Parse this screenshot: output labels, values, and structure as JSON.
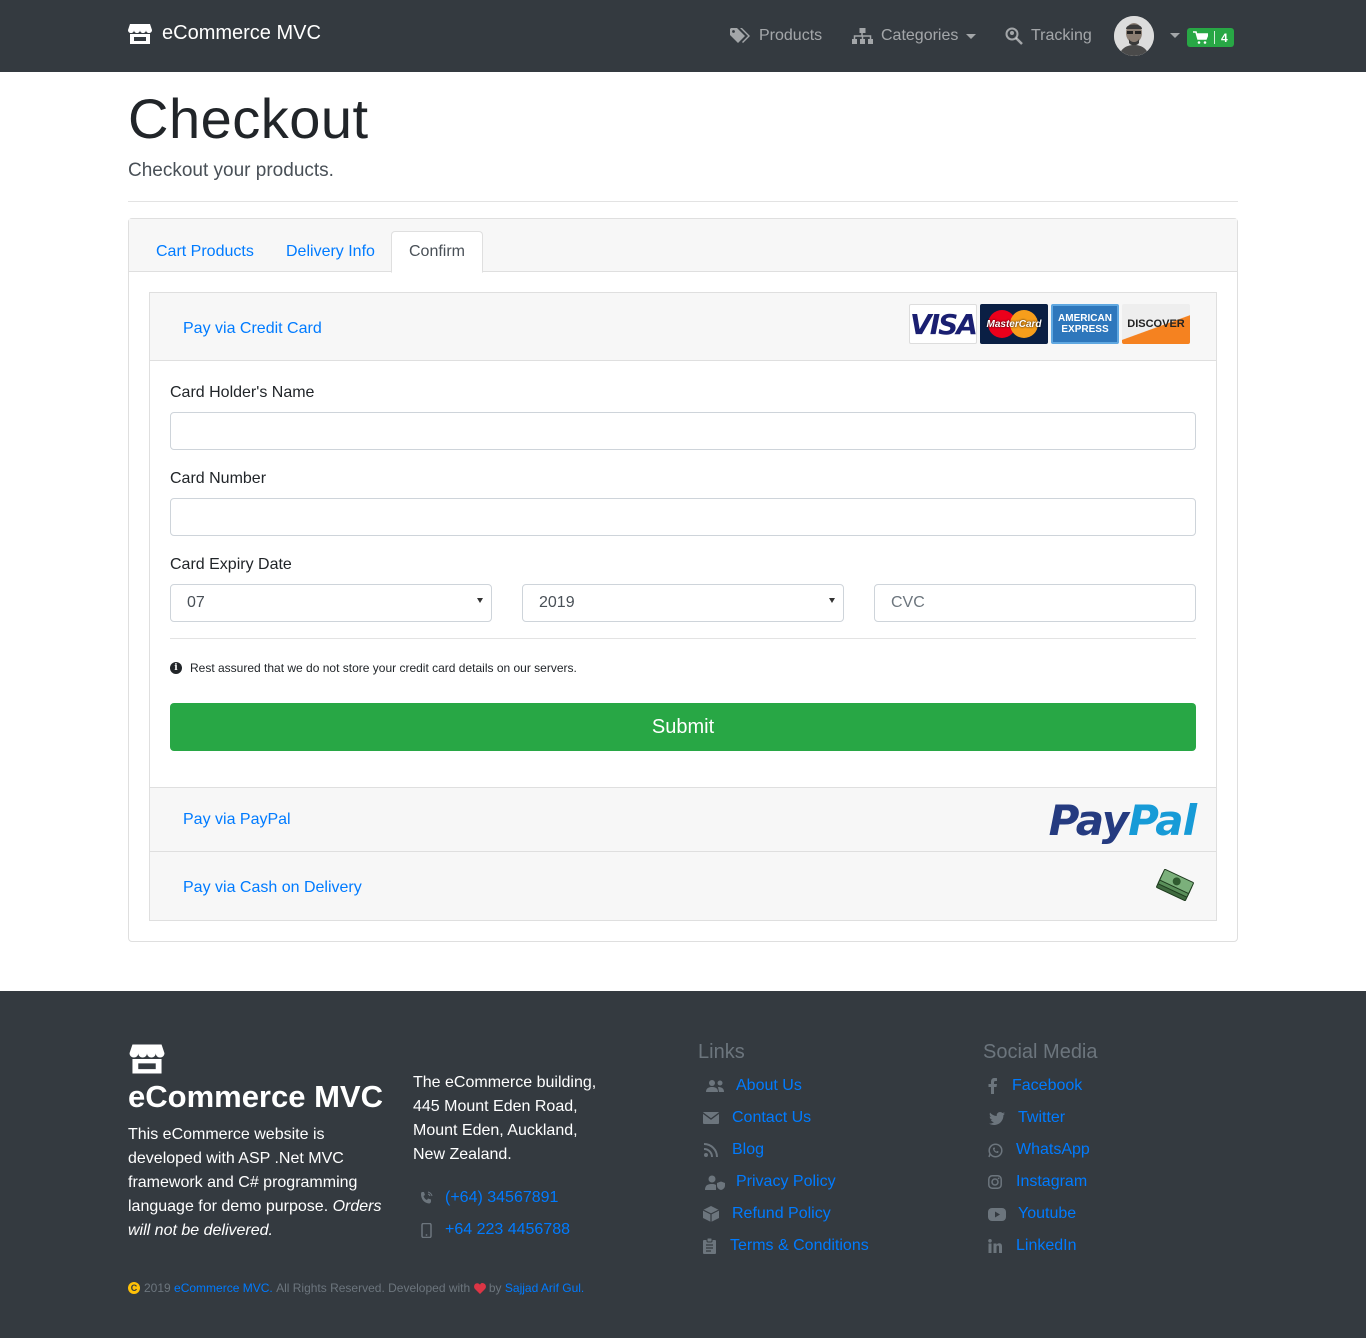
{
  "navbar": {
    "brand": "eCommerce MVC",
    "products": "Products",
    "categories": "Categories",
    "tracking": "Tracking",
    "cart_count": "4"
  },
  "header": {
    "title": "Checkout",
    "subtitle": "Checkout your products."
  },
  "tabs": [
    "Cart Products",
    "Delivery Info",
    "Confirm"
  ],
  "payment": {
    "credit_card_link": "Pay via Credit Card",
    "card_logos": [
      "VISA",
      "MasterCard",
      "AMERICAN EXPRESS",
      "DISCOVER"
    ],
    "holder_label": "Card Holder's Name",
    "number_label": "Card Number",
    "expiry_label": "Card Expiry Date",
    "month_value": "07",
    "year_value": "2019",
    "cvc_placeholder": "CVC",
    "note": "Rest assured that we do not store your credit card details on our servers.",
    "submit": "Submit",
    "paypal_link": "Pay via PayPal",
    "paypal_logo_a": "Pay",
    "paypal_logo_b": "Pal",
    "cod_link": "Pay via Cash on Delivery"
  },
  "footer": {
    "brand": "eCommerce MVC",
    "desc_plain": "This eCommerce website is developed with ASP .Net MVC framework and C# programming language for demo purpose. ",
    "desc_italic": "Orders will not be delivered.",
    "address_lines": [
      "The eCommerce building,",
      "445 Mount Eden Road,",
      "Mount Eden, Auckland,",
      "New Zealand."
    ],
    "phone": "(+64) 34567891",
    "mobile": "+64 223 4456788",
    "links_heading": "Links",
    "links": [
      "About Us",
      "Contact Us",
      "Blog",
      "Privacy Policy",
      "Refund Policy",
      "Terms & Conditions"
    ],
    "social_heading": "Social Media",
    "social": [
      "Facebook",
      "Twitter",
      "WhatsApp",
      "Instagram",
      "Youtube",
      "LinkedIn"
    ],
    "copy_year": "2019",
    "copy_brand": "eCommerce MVC.",
    "copy_rights": "All Rights Reserved. Developed with",
    "copy_by": "by",
    "copy_author": "Sajjad Arif Gul."
  }
}
